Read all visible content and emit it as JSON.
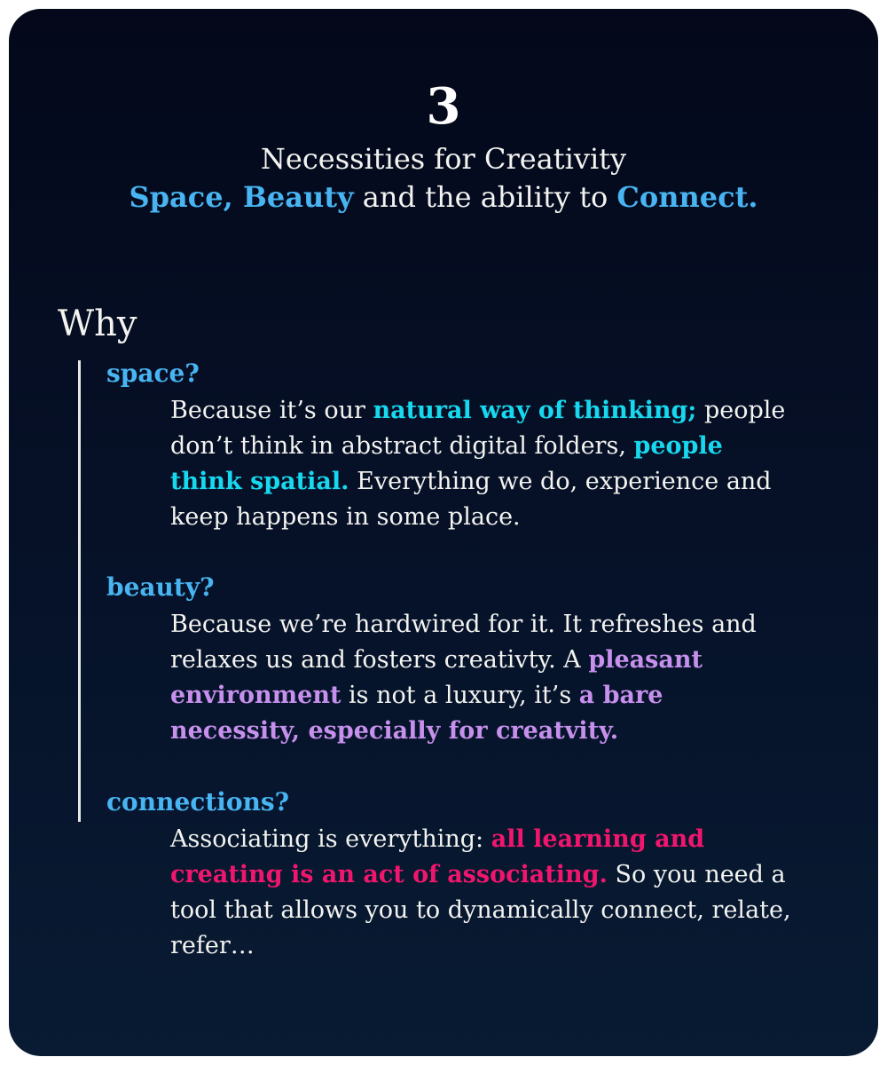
{
  "header": {
    "number": "3",
    "subtitle": "Necessities for Creativity",
    "tagline": {
      "part1": "Space, Beauty",
      "part2": " and the ability to ",
      "part3": "Connect."
    }
  },
  "why_label": "Why",
  "sections": {
    "space": {
      "label": "space?",
      "t1": "Because it’s our ",
      "h1": "natural way of thinking;",
      "t2": " people don’t think in abstract digital folders, ",
      "h2": "people think spatial.",
      "t3": " Everything we do, experience and keep happens in some place."
    },
    "beauty": {
      "label": "beauty?",
      "t1": "Because we’re hardwired for it. It refreshes and relaxes us and fosters creativty. A ",
      "h1": "pleasant environment",
      "t2": " is not a luxury, it’s ",
      "h2": "a bare necessity, especially for creatvity."
    },
    "connections": {
      "label": "connections?",
      "t1": "Associating is everything: ",
      "h1": "all learning and creating is an act of associating.",
      "t2": " So you need a tool that allows you to dynamically connect, relate, refer…"
    }
  },
  "colors": {
    "background_top": "#04081a",
    "background_bottom": "#081b33",
    "accent_blue": "#48b4f1",
    "accent_cyan": "#17d8ee",
    "accent_purple": "#c690ec",
    "accent_pink": "#f0166e",
    "text": "#f3f3f0"
  }
}
